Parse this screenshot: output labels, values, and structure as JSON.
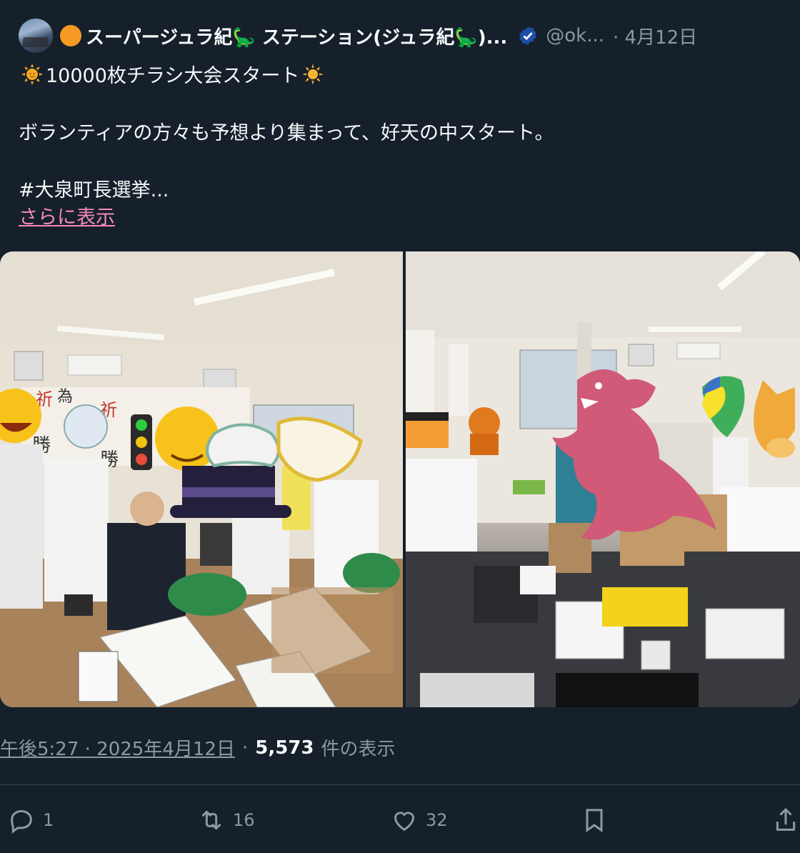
{
  "author": {
    "display_name": "スーパージュラ紀🦕 ステーション(ジュラ紀🦕)...",
    "handle": "@ok...",
    "date": "· 4月12日",
    "prefix_icon": "orange-circle-icon",
    "verified_icon": "verified-badge-icon"
  },
  "tweet": {
    "line1": "10000枚チラシ大会スタート",
    "line2": "ボランティアの方々も予想より集まって、好天の中スタート。",
    "line3": "#大泉町長選挙...",
    "show_more": "さらに表示"
  },
  "meta": {
    "time": "午後5:27 · 2025年4月12日",
    "separator": "·",
    "views": "5,573",
    "views_label": "件の表示"
  },
  "actions": {
    "reply_count": "1",
    "retweet_count": "16",
    "like_count": "32"
  },
  "colors": {
    "background": "#15202b",
    "text": "#f7f9f9",
    "muted": "#8b98a5",
    "link": "#f58ab6",
    "verified": "#1d4fa8"
  }
}
